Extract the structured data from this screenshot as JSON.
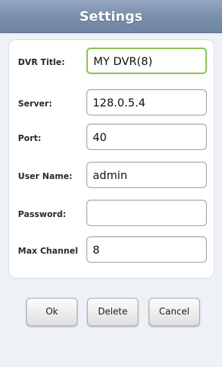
{
  "header": {
    "title": "Settings"
  },
  "form": {
    "dvr_title": {
      "label": "DVR Title:",
      "value": "MY DVR(8)"
    },
    "server": {
      "label": "Server:",
      "value": "128.0.5.4"
    },
    "port": {
      "label": "Port:",
      "value": "40"
    },
    "user_name": {
      "label": "User Name:",
      "value": "admin"
    },
    "password": {
      "label": "Password:",
      "value": ""
    },
    "max_channel": {
      "label": "Max Channel",
      "value": "8"
    }
  },
  "buttons": {
    "ok_label": "Ok",
    "delete_label": "Delete",
    "cancel_label": "Cancel"
  },
  "colors": {
    "titlebar": "#7a8fac",
    "focus_border": "#86c14a",
    "background": "#eef1f5"
  }
}
